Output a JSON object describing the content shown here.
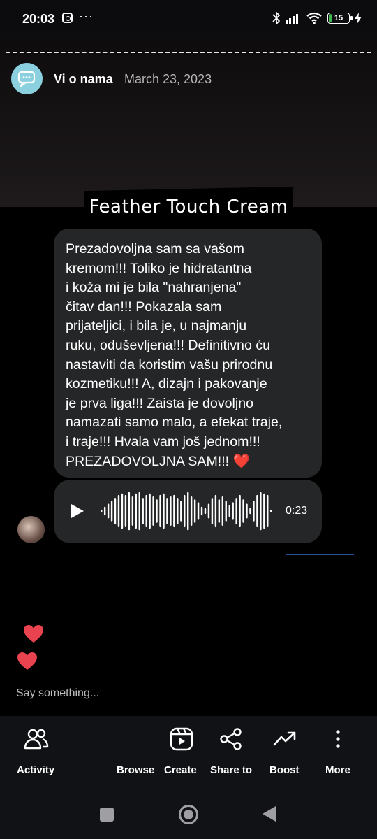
{
  "status_bar": {
    "time": "20:03",
    "more": "···",
    "battery": "15",
    "battery_level": 0.15
  },
  "story": {
    "author": "Vi o nama",
    "date": "March 23, 2023",
    "title": "Feather Touch Cream"
  },
  "message": {
    "text": "Prezadovoljna sam sa vašom\nkremom!!! Toliko je hidratantna\ni koža mi je bila \"nahranjena\"\nčitav dan!!! Pokazala sam\nprijateljici, i bila je, u najmanju\nruku, oduševljena!!! Definitivno ću\nnastaviti da koristim vašu prirodnu\nkozmetiku!!! A, dizajn i pakovanje\nje prva liga!!! Zaista je dovoljno\nnamazati samo malo, a efekat traje,\ni traje!!! Hvala vam još jednom!!!\nPREZADOVOLJNA SAM!!! ",
    "emoji": "❤️"
  },
  "audio": {
    "duration": "0:23"
  },
  "reply": {
    "placeholder": "Say something..."
  },
  "actions": {
    "activity": "Activity",
    "browse": "Browse",
    "create": "Create",
    "share": "Share to",
    "boost": "Boost",
    "more": "More"
  },
  "colors": {
    "heart": "#e8434f",
    "avatar_bg": "#8ad0df",
    "bubble": "#252627"
  }
}
